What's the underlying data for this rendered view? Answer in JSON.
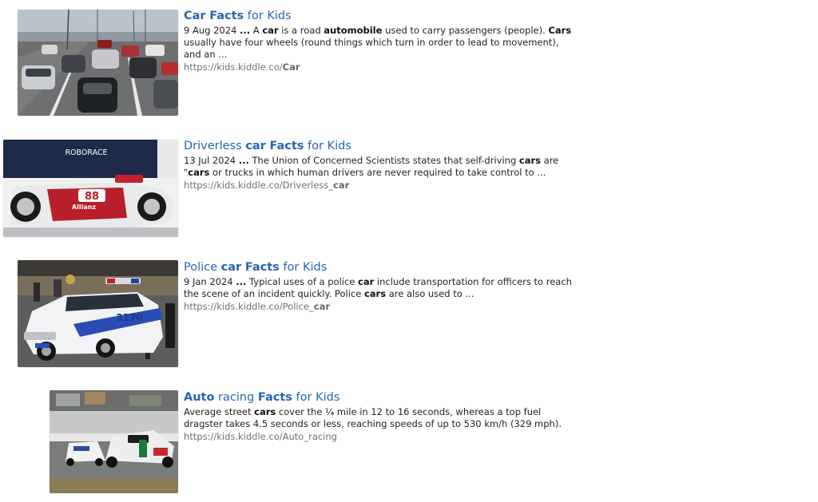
{
  "results": [
    {
      "title_parts": [
        {
          "text": "Car",
          "bold": true
        },
        {
          "text": " ",
          "bold": false
        },
        {
          "text": "Facts",
          "bold": true
        },
        {
          "text": " for Kids",
          "bold": false
        }
      ],
      "snippet_parts": [
        {
          "text": "9 Aug 2024 ",
          "bold": false
        },
        {
          "text": "...",
          "bold": true
        },
        {
          "text": " A ",
          "bold": false
        },
        {
          "text": "car",
          "bold": true
        },
        {
          "text": " is a road ",
          "bold": false
        },
        {
          "text": "automobile",
          "bold": true
        },
        {
          "text": " used to carry passengers (people). ",
          "bold": false
        },
        {
          "text": "Cars",
          "bold": true
        },
        {
          "text": " usually have four wheels (round things which turn in order to lead to movement), and an ...",
          "bold": false
        }
      ],
      "url_parts": [
        {
          "text": "https://kids.kiddle.co/",
          "bold": false
        },
        {
          "text": "Car",
          "bold": true
        }
      ],
      "image_alt": "Highway traffic with many cars"
    },
    {
      "title_parts": [
        {
          "text": "Driverless ",
          "bold": false
        },
        {
          "text": "car",
          "bold": true
        },
        {
          "text": " ",
          "bold": false
        },
        {
          "text": "Facts",
          "bold": true
        },
        {
          "text": " for Kids",
          "bold": false
        }
      ],
      "snippet_parts": [
        {
          "text": "13 Jul 2024 ",
          "bold": false
        },
        {
          "text": "...",
          "bold": true
        },
        {
          "text": " The Union of Concerned Scientists states that self-driving ",
          "bold": false
        },
        {
          "text": "cars",
          "bold": true
        },
        {
          "text": " are \"",
          "bold": false
        },
        {
          "text": "cars",
          "bold": true
        },
        {
          "text": " or trucks in which human drivers are never required to take control to ...",
          "bold": false
        }
      ],
      "url_parts": [
        {
          "text": "https://kids.kiddle.co/Driverless_",
          "bold": false
        },
        {
          "text": "car",
          "bold": true
        }
      ],
      "image_alt": "Roborace driverless race car",
      "image_text": {
        "banner": "ROBORACE",
        "number": "88",
        "sponsor": "Allianz"
      }
    },
    {
      "title_parts": [
        {
          "text": "Police ",
          "bold": false
        },
        {
          "text": "car",
          "bold": true
        },
        {
          "text": " ",
          "bold": false
        },
        {
          "text": "Facts",
          "bold": true
        },
        {
          "text": " for Kids",
          "bold": false
        }
      ],
      "snippet_parts": [
        {
          "text": "9 Jan 2024 ",
          "bold": false
        },
        {
          "text": "...",
          "bold": true
        },
        {
          "text": " Typical uses of a police ",
          "bold": false
        },
        {
          "text": "car",
          "bold": true
        },
        {
          "text": " include transportation for officers to reach the scene of an incident quickly. Police ",
          "bold": false
        },
        {
          "text": "cars",
          "bold": true
        },
        {
          "text": " are also used to ...",
          "bold": false
        }
      ],
      "url_parts": [
        {
          "text": "https://kids.kiddle.co/Police_",
          "bold": false
        },
        {
          "text": "car",
          "bold": true
        }
      ],
      "image_alt": "NYPD police car",
      "image_text": {
        "number": "3170"
      }
    },
    {
      "title_parts": [
        {
          "text": "Auto",
          "bold": true
        },
        {
          "text": " racing ",
          "bold": false
        },
        {
          "text": "Facts",
          "bold": true
        },
        {
          "text": " for Kids",
          "bold": false
        }
      ],
      "snippet_parts": [
        {
          "text": "Average street ",
          "bold": false
        },
        {
          "text": "cars",
          "bold": true
        },
        {
          "text": " cover the ¼ mile in 12 to 16 seconds, whereas a top fuel dragster takes 4.5 seconds or less, reaching speeds of up to 530 km/h (329 mph).",
          "bold": false
        }
      ],
      "url_parts": [
        {
          "text": "https://kids.kiddle.co/Auto_racing",
          "bold": false
        }
      ],
      "image_alt": "Race cars on a track"
    }
  ],
  "colors": {
    "title_link": "#2a63b3",
    "snippet_text": "#222222",
    "url_text": "#707070"
  }
}
